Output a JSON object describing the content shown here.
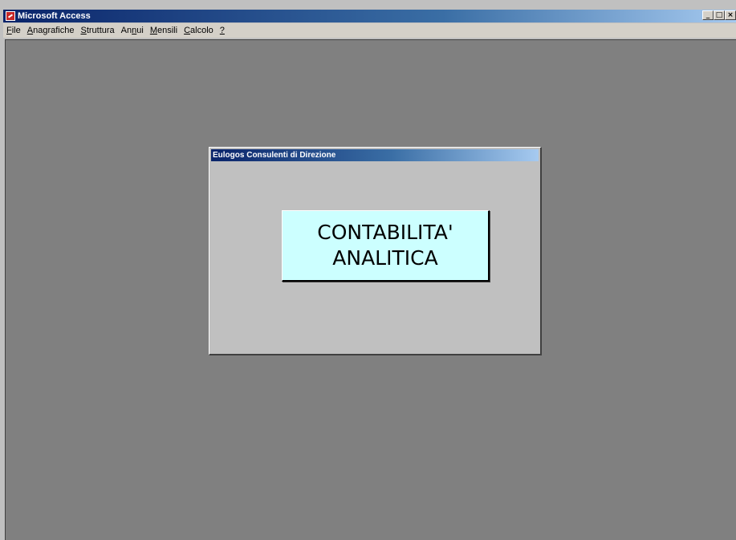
{
  "window": {
    "title": "Microsoft Access",
    "controls": [
      "_",
      "□",
      "×"
    ]
  },
  "menu": {
    "items": [
      {
        "pre": "",
        "key": "F",
        "post": "ile"
      },
      {
        "pre": "",
        "key": "A",
        "post": "nagrafiche"
      },
      {
        "pre": "",
        "key": "S",
        "post": "truttura"
      },
      {
        "pre": "An",
        "key": "n",
        "post": "ui"
      },
      {
        "pre": "",
        "key": "M",
        "post": "ensili"
      },
      {
        "pre": "",
        "key": "C",
        "post": "alcolo"
      },
      {
        "pre": "",
        "key": "?",
        "post": ""
      }
    ]
  },
  "form": {
    "title": "Eulogos Consulenti di Direzione",
    "banner_line1": "CONTABILITA'",
    "banner_line2": "ANALITICA"
  },
  "colors": {
    "titlebar_start": "#0a246a",
    "titlebar_end": "#a6caf0",
    "mdi_background": "#808080",
    "banner_background": "#ccffff"
  },
  "icons": {
    "app": "access-app-icon"
  }
}
